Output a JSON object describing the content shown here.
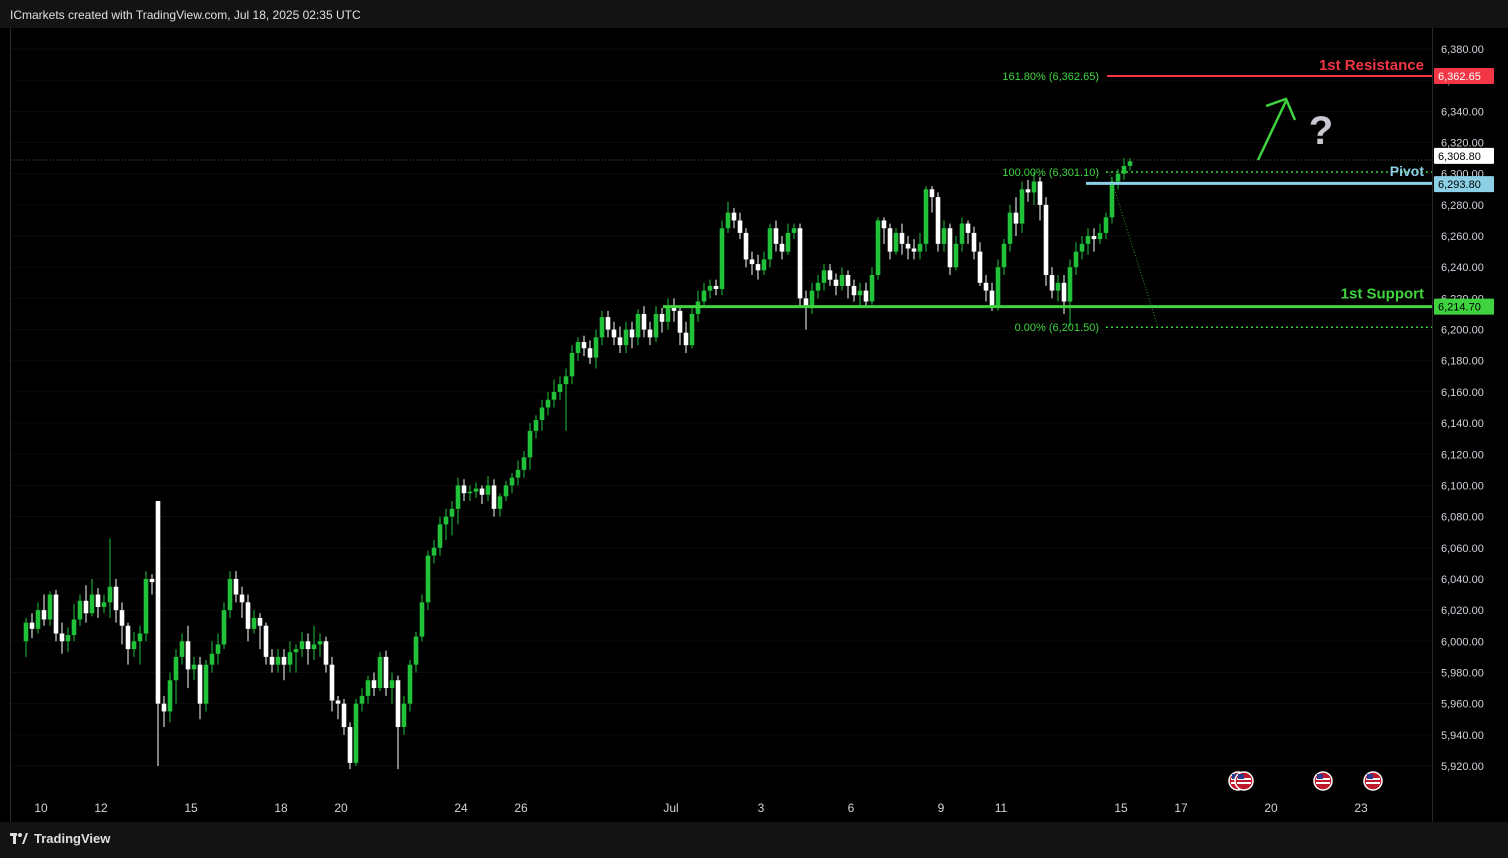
{
  "header": {
    "attribution": "ICmarkets created with TradingView.com, Jul 18, 2025 02:35 UTC"
  },
  "footer": {
    "brand": "TradingView"
  },
  "colors": {
    "up": "#22c13a",
    "down": "#ffffff",
    "resistance": "#f23645",
    "support": "#3fd33f",
    "pivot": "#8bd0e6",
    "fib": "#3fd33f",
    "background": "#000000"
  },
  "annotations": {
    "resistance_label": "1st Resistance",
    "support_label": "1st Support",
    "pivot_label": "Pivot",
    "fib_top": "161.80% (6,362.65)",
    "fib_mid": "100.00% (6,301.10)",
    "fib_bottom": "0.00% (6,201.50)",
    "question_mark": "?"
  },
  "axis_badges": {
    "resistance": "6,362.65",
    "last_price": "6,308.80",
    "pivot": "6,293.80",
    "support": "6,214.70"
  },
  "icons": {
    "event_flags": [
      "us-flag-icon",
      "us-flag-icon",
      "us-flag-icon"
    ]
  },
  "chart_data": {
    "type": "candlestick",
    "title": "",
    "y_ticks": [
      "6,380.00",
      "6,360.00",
      "6,340.00",
      "6,320.00",
      "6,300.00",
      "6,280.00",
      "6,260.00",
      "6,240.00",
      "6,220.00",
      "6,200.00",
      "6,180.00",
      "6,160.00",
      "6,140.00",
      "6,120.00",
      "6,100.00",
      "6,080.00",
      "6,060.00",
      "6,040.00",
      "6,020.00",
      "6,000.00",
      "5,980.00",
      "5,960.00",
      "5,940.00",
      "5,920.00"
    ],
    "y_tick_values": [
      6380,
      6360,
      6340,
      6320,
      6300,
      6280,
      6260,
      6240,
      6220,
      6200,
      6180,
      6160,
      6140,
      6120,
      6100,
      6080,
      6060,
      6040,
      6020,
      6000,
      5980,
      5960,
      5940,
      5920
    ],
    "ylim": [
      5910,
      6390
    ],
    "x_ticks": [
      "10",
      "12",
      "15",
      "18",
      "20",
      "24",
      "26",
      "Jul",
      "3",
      "6",
      "9",
      "11",
      "15",
      "17",
      "20",
      "23"
    ],
    "x_tick_days": [
      10,
      12,
      15,
      18,
      20,
      24,
      26,
      31,
      34,
      37,
      40,
      42,
      46,
      48,
      51,
      54
    ],
    "levels": {
      "resistance": 6362.65,
      "pivot": 6293.8,
      "support": 6214.7,
      "fib_0": 6201.5,
      "fib_100": 6301.1,
      "fib_161_8": 6362.65,
      "last_price": 6308.8
    },
    "candles": [
      [
        9.5,
        6000,
        6012,
        5990,
        6015
      ],
      [
        9.7,
        6012,
        6008,
        6002,
        6018
      ],
      [
        9.9,
        6008,
        6020,
        6005,
        6025
      ],
      [
        10.1,
        6020,
        6014,
        6010,
        6030
      ],
      [
        10.3,
        6014,
        6030,
        6010,
        6032
      ],
      [
        10.5,
        6030,
        6005,
        6000,
        6033
      ],
      [
        10.7,
        6005,
        6000,
        5992,
        6012
      ],
      [
        10.9,
        6000,
        6004,
        5993,
        6009
      ],
      [
        11.1,
        6004,
        6014,
        6000,
        6024
      ],
      [
        11.3,
        6014,
        6026,
        6010,
        6030
      ],
      [
        11.5,
        6026,
        6018,
        6012,
        6036
      ],
      [
        11.7,
        6018,
        6030,
        6016,
        6040
      ],
      [
        11.9,
        6030,
        6022,
        6015,
        6034
      ],
      [
        12.1,
        6022,
        6025,
        6018,
        6030
      ],
      [
        12.3,
        6025,
        6035,
        6015,
        6066
      ],
      [
        12.5,
        6035,
        6020,
        6012,
        6040
      ],
      [
        12.7,
        6020,
        6010,
        5998,
        6025
      ],
      [
        12.9,
        6010,
        5995,
        5985,
        6012
      ],
      [
        13.1,
        5995,
        6000,
        5990,
        6006
      ],
      [
        13.3,
        6000,
        6005,
        5985,
        6010
      ],
      [
        13.5,
        6005,
        6040,
        6000,
        6045
      ],
      [
        13.7,
        6040,
        6038,
        6030,
        6043
      ],
      [
        13.9,
        6090,
        5960,
        5920,
        6090
      ],
      [
        14.1,
        5960,
        5955,
        5945,
        5965
      ],
      [
        14.3,
        5955,
        5975,
        5948,
        5980
      ],
      [
        14.5,
        5975,
        5990,
        5960,
        5995
      ],
      [
        14.7,
        5990,
        6000,
        5985,
        6005
      ],
      [
        14.9,
        6000,
        5982,
        5970,
        6010
      ],
      [
        15.1,
        5982,
        5985,
        5975,
        5990
      ],
      [
        15.3,
        5985,
        5960,
        5950,
        5990
      ],
      [
        15.5,
        5960,
        5985,
        5955,
        5988
      ],
      [
        15.7,
        5985,
        5992,
        5980,
        6000
      ],
      [
        15.9,
        5992,
        5998,
        5985,
        6005
      ],
      [
        16.1,
        5998,
        6020,
        5995,
        6025
      ],
      [
        16.3,
        6020,
        6040,
        6015,
        6045
      ],
      [
        16.5,
        6040,
        6030,
        6025,
        6045
      ],
      [
        16.7,
        6030,
        6025,
        6015,
        6035
      ],
      [
        16.9,
        6025,
        6008,
        6000,
        6030
      ],
      [
        17.1,
        6008,
        6015,
        6005,
        6020
      ],
      [
        17.3,
        6015,
        6010,
        5995,
        6018
      ],
      [
        17.5,
        6010,
        5990,
        5985,
        6012
      ],
      [
        17.7,
        5990,
        5985,
        5980,
        5995
      ],
      [
        17.9,
        5985,
        5990,
        5980,
        5995
      ],
      [
        18.1,
        5990,
        5985,
        5975,
        5995
      ],
      [
        18.3,
        5985,
        5993,
        5980,
        6000
      ],
      [
        18.5,
        5993,
        5995,
        5980,
        5998
      ],
      [
        18.7,
        5995,
        6000,
        5990,
        6006
      ],
      [
        18.9,
        6000,
        5995,
        5985,
        6005
      ],
      [
        19.1,
        5995,
        5998,
        5988,
        6010
      ],
      [
        19.3,
        5998,
        6000,
        5990,
        6005
      ],
      [
        19.5,
        6000,
        5985,
        5980,
        6003
      ],
      [
        19.7,
        5985,
        5962,
        5955,
        5990
      ],
      [
        19.9,
        5962,
        5960,
        5950,
        5965
      ],
      [
        20.1,
        5960,
        5945,
        5940,
        5963
      ],
      [
        20.3,
        5945,
        5922,
        5918,
        5948
      ],
      [
        20.5,
        5922,
        5960,
        5920,
        5963
      ],
      [
        20.7,
        5960,
        5965,
        5955,
        5970
      ],
      [
        20.9,
        5965,
        5975,
        5960,
        5978
      ],
      [
        21.1,
        5975,
        5970,
        5965,
        5980
      ],
      [
        21.3,
        5970,
        5990,
        5968,
        5993
      ],
      [
        21.5,
        5990,
        5970,
        5965,
        5994
      ],
      [
        21.7,
        5970,
        5975,
        5960,
        5980
      ],
      [
        21.9,
        5975,
        5945,
        5918,
        5978
      ],
      [
        22.1,
        5945,
        5960,
        5940,
        5965
      ],
      [
        22.3,
        5960,
        5985,
        5955,
        5988
      ],
      [
        22.5,
        5985,
        6003,
        5980,
        6006
      ],
      [
        22.7,
        6003,
        6025,
        6000,
        6030
      ],
      [
        22.9,
        6025,
        6055,
        6020,
        6058
      ],
      [
        23.1,
        6055,
        6060,
        6050,
        6065
      ],
      [
        23.3,
        6060,
        6075,
        6055,
        6080
      ],
      [
        23.5,
        6075,
        6080,
        6065,
        6085
      ],
      [
        23.7,
        6080,
        6085,
        6068,
        6090
      ],
      [
        23.9,
        6085,
        6100,
        6075,
        6105
      ],
      [
        24.1,
        6100,
        6095,
        6090,
        6104
      ],
      [
        24.3,
        6095,
        6096,
        6090,
        6100
      ],
      [
        24.5,
        6096,
        6098,
        6092,
        6102
      ],
      [
        24.7,
        6098,
        6094,
        6088,
        6100
      ],
      [
        24.9,
        6094,
        6100,
        6090,
        6106
      ],
      [
        25.1,
        6100,
        6085,
        6080,
        6104
      ],
      [
        25.3,
        6085,
        6093,
        6080,
        6095
      ],
      [
        25.5,
        6093,
        6100,
        6090,
        6103
      ],
      [
        25.7,
        6100,
        6105,
        6095,
        6108
      ],
      [
        25.9,
        6105,
        6110,
        6100,
        6116
      ],
      [
        26.1,
        6110,
        6118,
        6105,
        6122
      ],
      [
        26.3,
        6118,
        6135,
        6110,
        6140
      ],
      [
        26.5,
        6135,
        6142,
        6130,
        6145
      ],
      [
        26.7,
        6142,
        6150,
        6135,
        6155
      ],
      [
        26.9,
        6150,
        6155,
        6145,
        6160
      ],
      [
        27.1,
        6155,
        6160,
        6150,
        6168
      ],
      [
        27.3,
        6160,
        6165,
        6155,
        6170
      ],
      [
        27.5,
        6165,
        6170,
        6135,
        6175
      ],
      [
        27.7,
        6170,
        6185,
        6165,
        6190
      ],
      [
        27.9,
        6185,
        6192,
        6180,
        6195
      ],
      [
        28.1,
        6192,
        6188,
        6183,
        6196
      ],
      [
        28.3,
        6188,
        6182,
        6178,
        6193
      ],
      [
        28.5,
        6182,
        6195,
        6175,
        6200
      ],
      [
        28.7,
        6195,
        6208,
        6190,
        6212
      ],
      [
        28.9,
        6208,
        6200,
        6195,
        6212
      ],
      [
        29.1,
        6200,
        6195,
        6190,
        6205
      ],
      [
        29.3,
        6195,
        6190,
        6185,
        6202
      ],
      [
        29.5,
        6190,
        6200,
        6185,
        6205
      ],
      [
        29.7,
        6200,
        6195,
        6188,
        6205
      ],
      [
        29.9,
        6195,
        6210,
        6190,
        6213
      ],
      [
        30.1,
        6210,
        6200,
        6195,
        6215
      ],
      [
        30.3,
        6200,
        6195,
        6190,
        6205
      ],
      [
        30.5,
        6195,
        6210,
        6192,
        6215
      ],
      [
        30.7,
        6210,
        6205,
        6198,
        6214
      ],
      [
        30.9,
        6205,
        6215,
        6200,
        6220
      ],
      [
        31.1,
        6215,
        6212,
        6205,
        6220
      ],
      [
        31.3,
        6212,
        6198,
        6190,
        6215
      ],
      [
        31.5,
        6198,
        6190,
        6185,
        6205
      ],
      [
        31.7,
        6190,
        6210,
        6188,
        6215
      ],
      [
        31.9,
        6210,
        6218,
        6205,
        6225
      ],
      [
        32.1,
        6218,
        6225,
        6215,
        6230
      ],
      [
        32.3,
        6225,
        6228,
        6220,
        6232
      ],
      [
        32.5,
        6228,
        6226,
        6222,
        6232
      ],
      [
        32.7,
        6226,
        6265,
        6222,
        6270
      ],
      [
        32.9,
        6265,
        6275,
        6262,
        6282
      ],
      [
        33.1,
        6275,
        6270,
        6265,
        6278
      ],
      [
        33.3,
        6270,
        6262,
        6258,
        6275
      ],
      [
        33.5,
        6262,
        6245,
        6240,
        6265
      ],
      [
        33.7,
        6245,
        6242,
        6235,
        6250
      ],
      [
        33.9,
        6242,
        6238,
        6232,
        6248
      ],
      [
        34.1,
        6238,
        6245,
        6235,
        6250
      ],
      [
        34.3,
        6245,
        6265,
        6240,
        6268
      ],
      [
        34.5,
        6265,
        6255,
        6250,
        6270
      ],
      [
        34.7,
        6255,
        6250,
        6245,
        6260
      ],
      [
        34.9,
        6250,
        6262,
        6248,
        6268
      ],
      [
        35.1,
        6262,
        6265,
        6258,
        6268
      ],
      [
        35.3,
        6265,
        6220,
        6215,
        6268
      ],
      [
        35.5,
        6220,
        6215,
        6200,
        6225
      ],
      [
        35.7,
        6215,
        6225,
        6210,
        6230
      ],
      [
        35.9,
        6225,
        6230,
        6220,
        6235
      ],
      [
        36.1,
        6230,
        6238,
        6225,
        6242
      ],
      [
        36.3,
        6238,
        6232,
        6228,
        6242
      ],
      [
        36.5,
        6232,
        6228,
        6222,
        6236
      ],
      [
        36.7,
        6228,
        6235,
        6225,
        6240
      ],
      [
        36.9,
        6235,
        6228,
        6220,
        6238
      ],
      [
        37.1,
        6228,
        6222,
        6218,
        6232
      ],
      [
        37.3,
        6222,
        6225,
        6215,
        6230
      ],
      [
        37.5,
        6225,
        6218,
        6214,
        6230
      ],
      [
        37.7,
        6218,
        6235,
        6216,
        6240
      ],
      [
        37.9,
        6235,
        6270,
        6232,
        6272
      ],
      [
        38.1,
        6270,
        6265,
        6255,
        6272
      ],
      [
        38.3,
        6265,
        6250,
        6245,
        6268
      ],
      [
        38.5,
        6250,
        6262,
        6248,
        6265
      ],
      [
        38.7,
        6262,
        6255,
        6248,
        6268
      ],
      [
        38.9,
        6255,
        6252,
        6245,
        6260
      ],
      [
        39.1,
        6252,
        6250,
        6245,
        6258
      ],
      [
        39.3,
        6250,
        6255,
        6245,
        6262
      ],
      [
        39.5,
        6255,
        6290,
        6250,
        6292
      ],
      [
        39.7,
        6290,
        6285,
        6275,
        6292
      ],
      [
        39.9,
        6285,
        6255,
        6250,
        6288
      ],
      [
        40.1,
        6255,
        6265,
        6250,
        6270
      ],
      [
        40.3,
        6265,
        6240,
        6235,
        6268
      ],
      [
        40.5,
        6240,
        6255,
        6238,
        6260
      ],
      [
        40.7,
        6255,
        6268,
        6250,
        6272
      ],
      [
        40.9,
        6268,
        6262,
        6255,
        6270
      ],
      [
        41.1,
        6262,
        6250,
        6245,
        6266
      ],
      [
        41.3,
        6250,
        6230,
        6228,
        6256
      ],
      [
        41.5,
        6230,
        6225,
        6218,
        6235
      ],
      [
        41.7,
        6225,
        6215,
        6212,
        6230
      ],
      [
        41.9,
        6215,
        6240,
        6212,
        6245
      ],
      [
        42.1,
        6240,
        6255,
        6235,
        6258
      ],
      [
        42.3,
        6255,
        6275,
        6250,
        6280
      ],
      [
        42.5,
        6275,
        6268,
        6260,
        6285
      ],
      [
        42.7,
        6268,
        6290,
        6262,
        6295
      ],
      [
        42.9,
        6290,
        6288,
        6282,
        6296
      ],
      [
        43.1,
        6288,
        6295,
        6280,
        6301
      ],
      [
        43.3,
        6295,
        6280,
        6270,
        6298
      ],
      [
        43.5,
        6280,
        6235,
        6228,
        6285
      ],
      [
        43.7,
        6235,
        6225,
        6220,
        6240
      ],
      [
        43.9,
        6225,
        6230,
        6218,
        6235
      ],
      [
        44.1,
        6230,
        6218,
        6210,
        6235
      ],
      [
        44.3,
        6218,
        6240,
        6202,
        6245
      ],
      [
        44.5,
        6240,
        6250,
        6235,
        6256
      ],
      [
        44.7,
        6250,
        6255,
        6245,
        6260
      ],
      [
        44.9,
        6255,
        6260,
        6248,
        6265
      ],
      [
        45.1,
        6260,
        6258,
        6250,
        6265
      ],
      [
        45.3,
        6258,
        6262,
        6255,
        6268
      ],
      [
        45.5,
        6262,
        6272,
        6258,
        6275
      ],
      [
        45.7,
        6272,
        6295,
        6268,
        6298
      ],
      [
        45.9,
        6295,
        6300,
        6290,
        6303
      ],
      [
        46.1,
        6300,
        6305,
        6296,
        6310
      ],
      [
        46.3,
        6305,
        6308,
        6302,
        6310
      ]
    ]
  }
}
